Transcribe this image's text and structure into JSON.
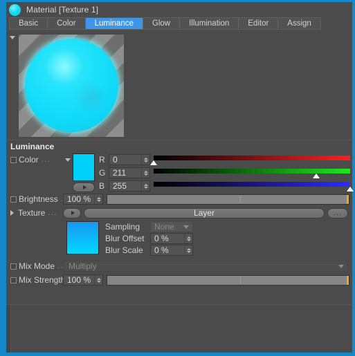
{
  "window": {
    "title": "Material [Texture 1]",
    "icon": "material-sphere-icon",
    "border_color": "#1389ca"
  },
  "tabs": [
    {
      "label": "Basic",
      "active": false
    },
    {
      "label": "Color",
      "active": false
    },
    {
      "label": "Luminance",
      "active": true
    },
    {
      "label": "Glow",
      "active": false
    },
    {
      "label": "Illumination",
      "active": false
    },
    {
      "label": "Editor",
      "active": false
    },
    {
      "label": "Assign",
      "active": false
    }
  ],
  "section": {
    "title": "Luminance"
  },
  "color": {
    "label": "Color",
    "dots": "...",
    "swatch_hex": "#00cff8",
    "channels": [
      {
        "letter": "R",
        "value": "0",
        "percent": 0.0
      },
      {
        "letter": "G",
        "value": "211",
        "percent": 82.7
      },
      {
        "letter": "B",
        "value": "255",
        "percent": 100.0
      }
    ]
  },
  "brightness": {
    "label": "Brightness",
    "dots": ".",
    "value": "100 %",
    "fill_percent": 100,
    "tick_percent": 55
  },
  "texture": {
    "label": "Texture",
    "dots": "...",
    "value": "Layer",
    "more_button": "...",
    "thumbnail": "gradient-blue-cyan-thumb",
    "sampling": {
      "label": "Sampling",
      "value": "None"
    },
    "blur_offset": {
      "label": "Blur Offset",
      "value": "0 %"
    },
    "blur_scale": {
      "label": "Blur Scale",
      "value": "0 %"
    }
  },
  "mix_mode": {
    "label": "Mix Mode",
    "dots": "..",
    "value": "Multiply"
  },
  "mix_strength": {
    "label": "Mix Strength",
    "value": "100 %",
    "fill_percent": 100,
    "tick_percent": 55
  }
}
